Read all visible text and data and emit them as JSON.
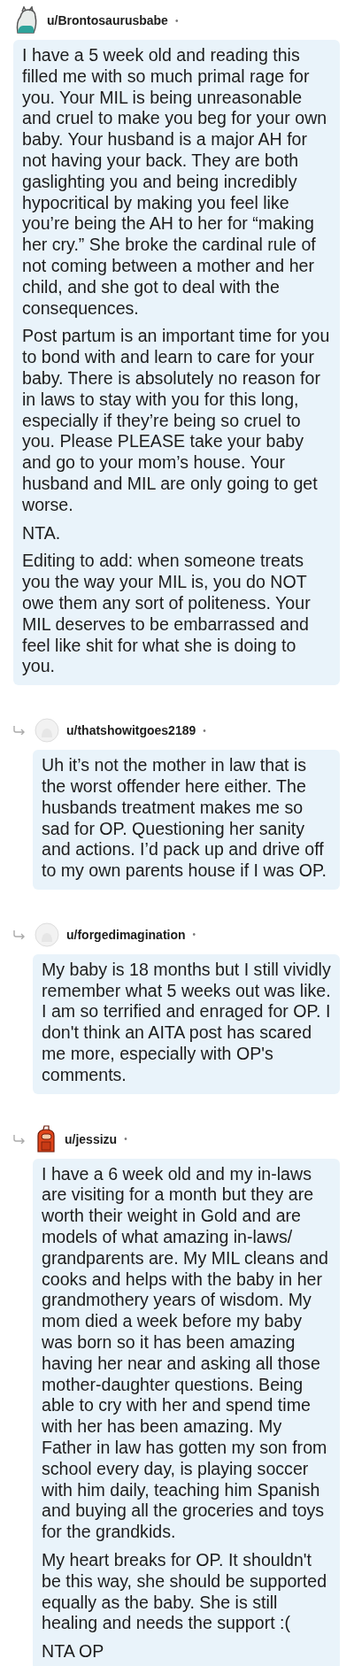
{
  "comments": [
    {
      "author": "u/Brontosaurusbabe",
      "dot": "•",
      "reply": false,
      "paragraphs": [
        "I have a 5 week old and reading this filled me with so much primal rage for you. Your MIL is being unreasonable and cruel to make you beg for your own baby. Your husband is a major AH for not having your back. They are both gaslighting you and being incredibly hypocritical by making you feel like you’re being the AH to her for “making her cry.” She broke the cardinal rule of not coming between a mother and her child, and she got to deal with the consequences.",
        "Post partum is an important time for you to bond with and learn to care for your baby. There is absolutely no reason for in laws to stay with you for this long, especially if they’re being so cruel to you. Please PLEASE take your baby and go to your mom’s house. Your husband and MIL are only going to get worse.",
        "NTA.",
        "Editing to add: when someone treats you the way your MIL is, you do NOT owe them any sort of politeness. Your MIL deserves to be embarrassed and feel like shit for what she is doing to you."
      ]
    },
    {
      "author": "u/thatshowitgoes2189",
      "dot": "•",
      "reply": true,
      "paragraphs": [
        "Uh it’s not the mother in law that is the worst offender here either. The husbands treatment makes me so sad for OP. Questioning her sanity and actions. I’d pack up and drive off to my own parents house if I was OP."
      ]
    },
    {
      "author": "u/forgedimagination",
      "dot": "•",
      "reply": true,
      "paragraphs": [
        "My baby is 18 months but I still vividly remember what 5 weeks out was like. I am so terrified and enraged for OP. I don't think an AITA post has scared me more, especially with OP's comments."
      ]
    },
    {
      "author": "u/jessizu",
      "dot": "•",
      "reply": true,
      "paragraphs": [
        "I have a 6 week old and my in-laws are visiting for a month but they are worth their weight in Gold and are models of what amazing in-laws/ grandparents are. My MIL cleans and cooks and helps with the baby in her grandmothery years of wisdom. My mom died a week before my baby was born so it has been amazing having her near and asking all those mother-daughter questions. Being able to cry with her and spend time with her has been amazing. My Father in law has gotten my son from school every day, is playing soccer with him daily, teaching him Spanish and buying all the groceries and toys for the grandkids.",
        "My heart breaks for OP. It shouldn't be this way, she should be supported equally as the baby. She is still healing and needs the support :(",
        "NTA OP"
      ]
    }
  ]
}
